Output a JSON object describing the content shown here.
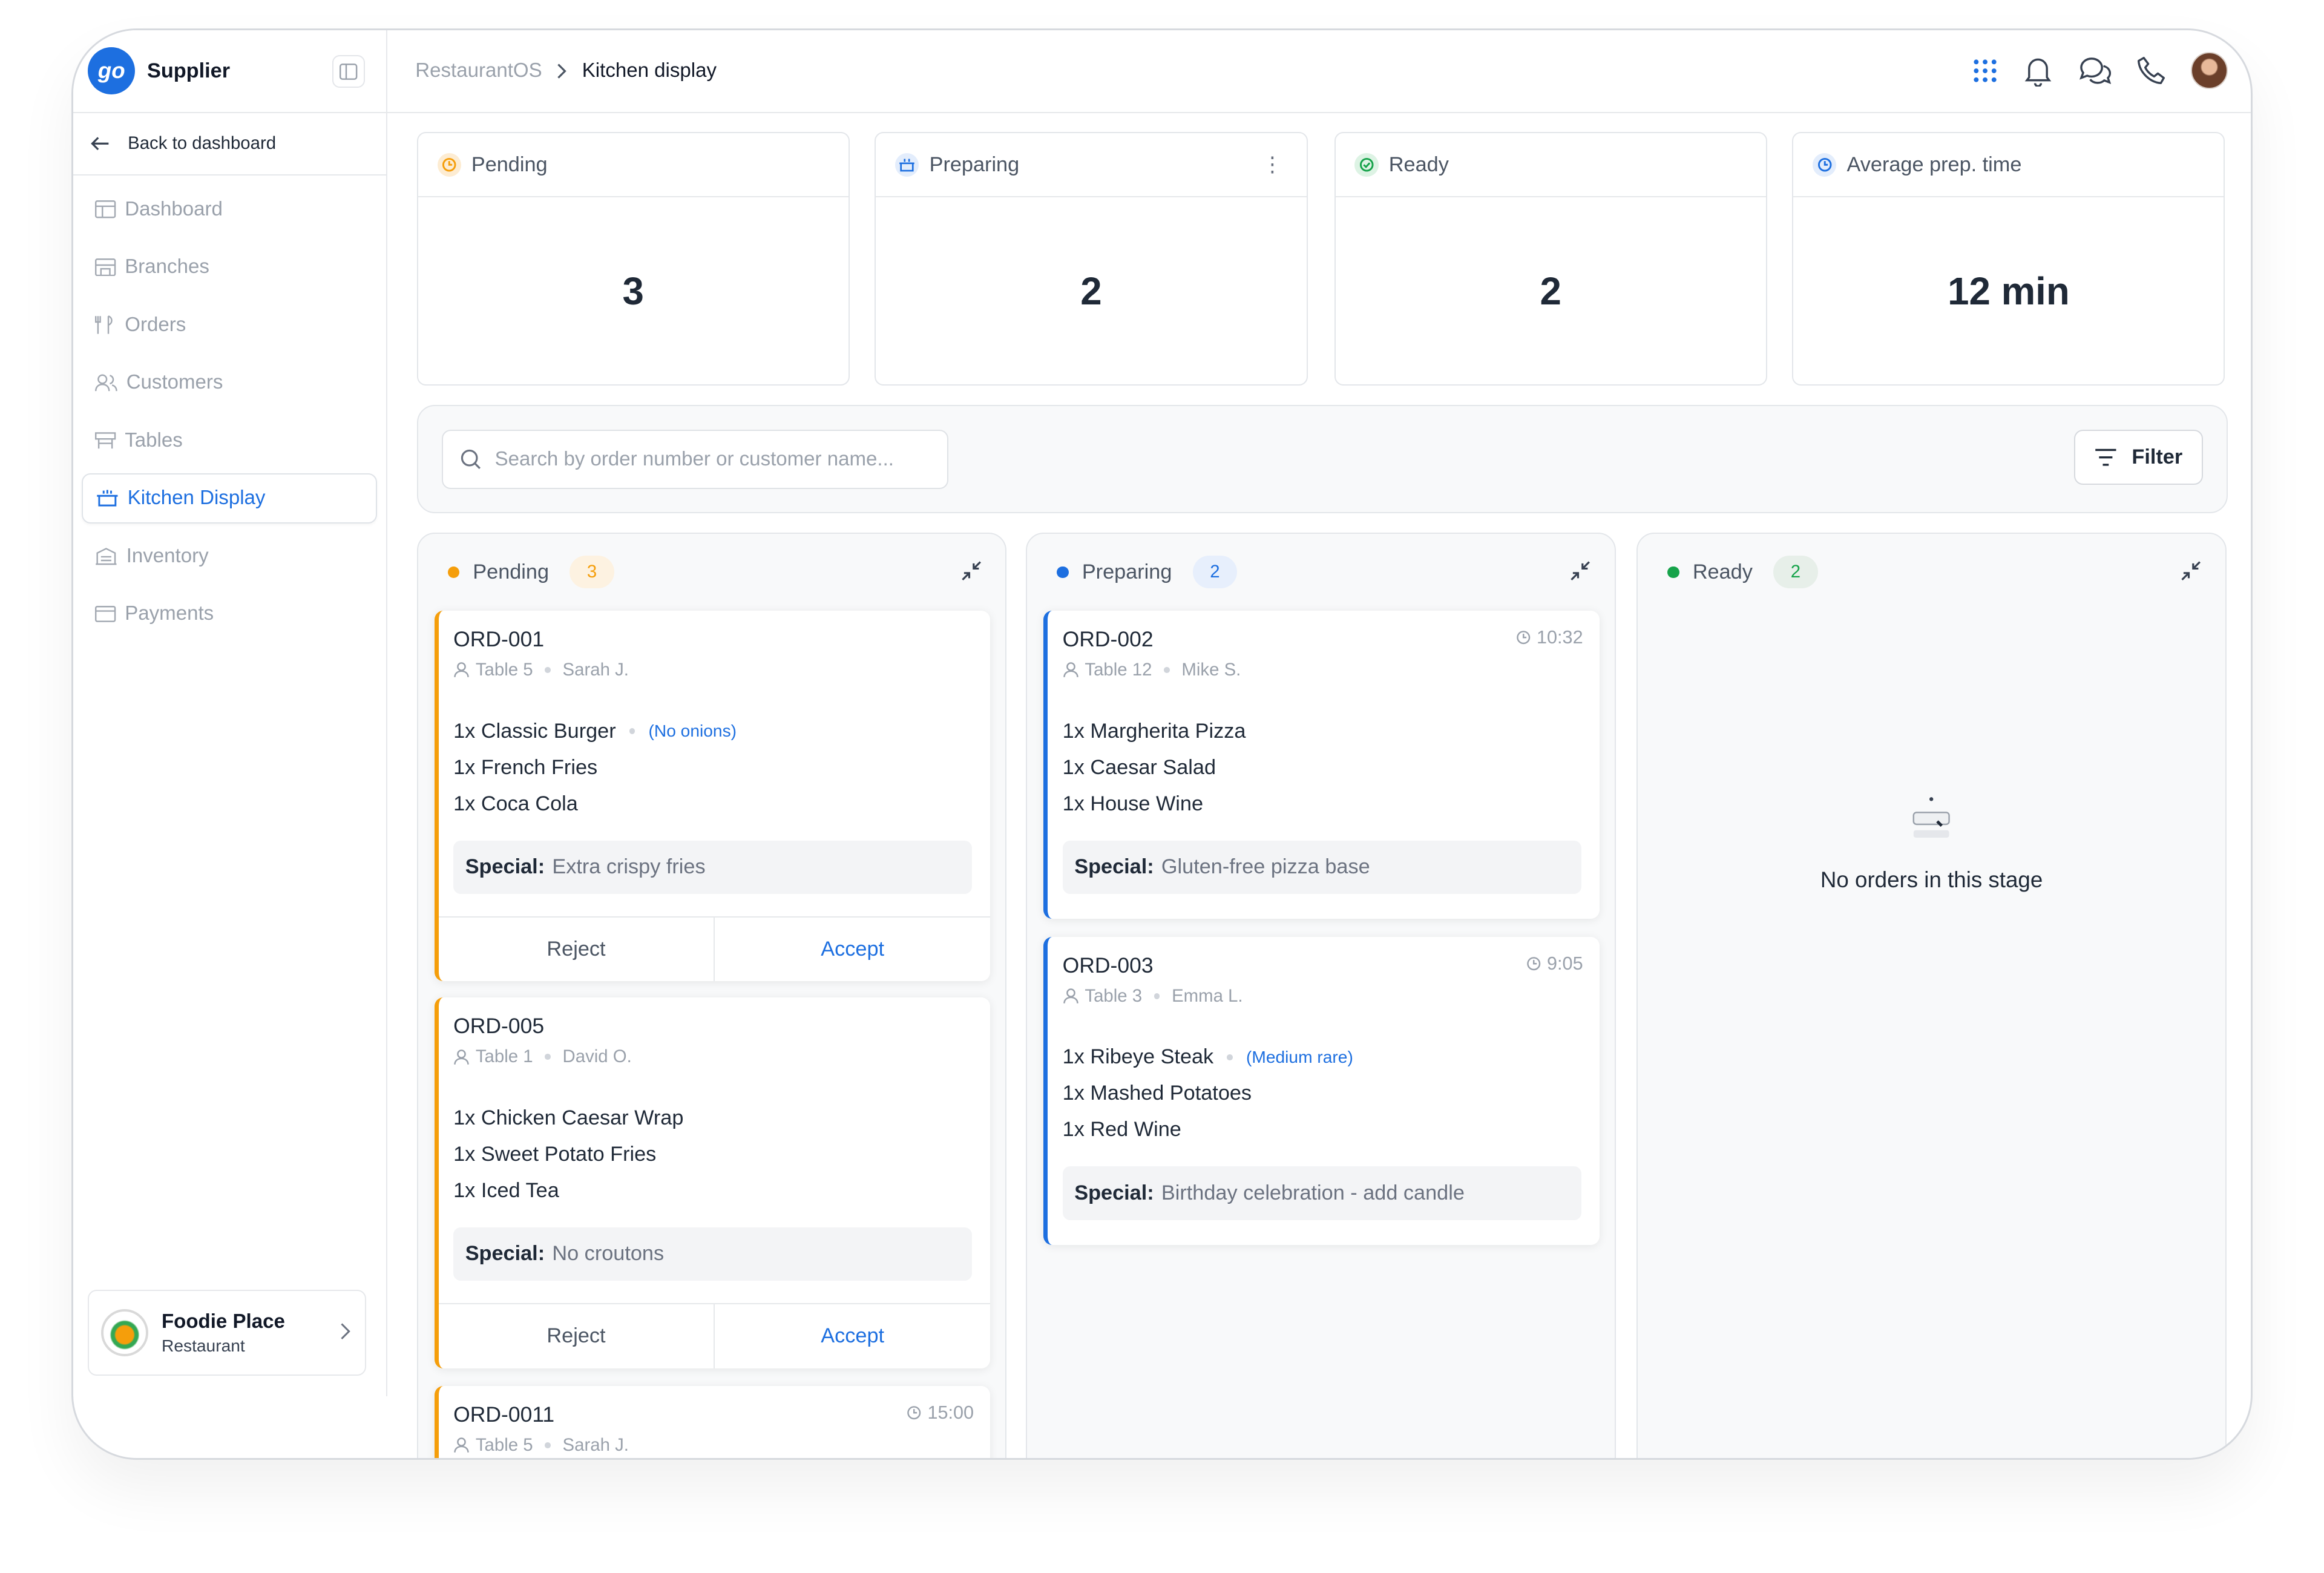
{
  "app": {
    "brand": "Supplier",
    "logo_text": "go"
  },
  "header": {
    "breadcrumb_root": "RestaurantOS",
    "breadcrumb_current": "Kitchen display",
    "icons": [
      "apps-grid-icon",
      "bell-icon",
      "chat-icon",
      "phone-icon",
      "user-avatar"
    ]
  },
  "sidebar": {
    "back_label": "Back to dashboard",
    "items": [
      {
        "label": "Dashboard",
        "icon": "dashboard-icon",
        "active": false
      },
      {
        "label": "Branches",
        "icon": "store-icon",
        "active": false
      },
      {
        "label": "Orders",
        "icon": "utensils-icon",
        "active": false
      },
      {
        "label": "Customers",
        "icon": "users-icon",
        "active": false
      },
      {
        "label": "Tables",
        "icon": "table-icon",
        "active": false
      },
      {
        "label": "Kitchen Display",
        "icon": "cooking-pot-icon",
        "active": true
      },
      {
        "label": "Inventory",
        "icon": "inventory-icon",
        "active": false
      },
      {
        "label": "Payments",
        "icon": "credit-card-icon",
        "active": false
      }
    ],
    "workspace": {
      "name": "Foodie Place",
      "type": "Restaurant"
    }
  },
  "stats": [
    {
      "label": "Pending",
      "value": "3",
      "color": "#f59e0b"
    },
    {
      "label": "Preparing",
      "value": "2",
      "color": "#1d6fe0"
    },
    {
      "label": "Ready",
      "value": "2",
      "color": "#16a34a"
    },
    {
      "label": "Average prep. time",
      "value": "12 min",
      "color": "#1d6fe0"
    }
  ],
  "search": {
    "placeholder": "Search by order number or customer name..."
  },
  "filter_label": "Filter",
  "columns": {
    "pending": {
      "title": "Pending",
      "count": "3",
      "color": "#f59e0b",
      "orders": [
        {
          "id": "ORD-001",
          "table": "Table 5",
          "customer": "Sarah J.",
          "time": "",
          "items": [
            "1x Classic Burger",
            "1x French Fries",
            "1x Coca Cola"
          ],
          "note": "(No onions)",
          "special_label": "Special:",
          "special": "Extra crispy fries",
          "reject": "Reject",
          "accept": "Accept"
        },
        {
          "id": "ORD-005",
          "table": "Table 1",
          "customer": "David O.",
          "time": "",
          "items": [
            "1x Chicken Caesar Wrap",
            "1x Sweet Potato Fries",
            "1x Iced Tea"
          ],
          "special_label": "Special:",
          "special": "No croutons",
          "reject": "Reject",
          "accept": "Accept"
        },
        {
          "id": "ORD-0011",
          "table": "Table 5",
          "customer": "Sarah J.",
          "time": "15:00"
        }
      ]
    },
    "preparing": {
      "title": "Preparing",
      "count": "2",
      "color": "#1d6fe0",
      "orders": [
        {
          "id": "ORD-002",
          "table": "Table 12",
          "customer": "Mike S.",
          "time": "10:32",
          "items": [
            "1x Margherita Pizza",
            "1x Caesar Salad",
            "1x House Wine"
          ],
          "special_label": "Special:",
          "special": "Gluten-free pizza base"
        },
        {
          "id": "ORD-003",
          "table": "Table 3",
          "customer": "Emma L.",
          "time": "9:05",
          "items": [
            "1x Ribeye Steak",
            "1x Mashed Potatoes",
            "1x Red Wine"
          ],
          "note": "(Medium rare)",
          "special_label": "Special:",
          "special": "Birthday celebration - add candle"
        }
      ]
    },
    "ready": {
      "title": "Ready",
      "count": "2",
      "color": "#16a34a",
      "empty_text": "No orders in this stage"
    }
  }
}
